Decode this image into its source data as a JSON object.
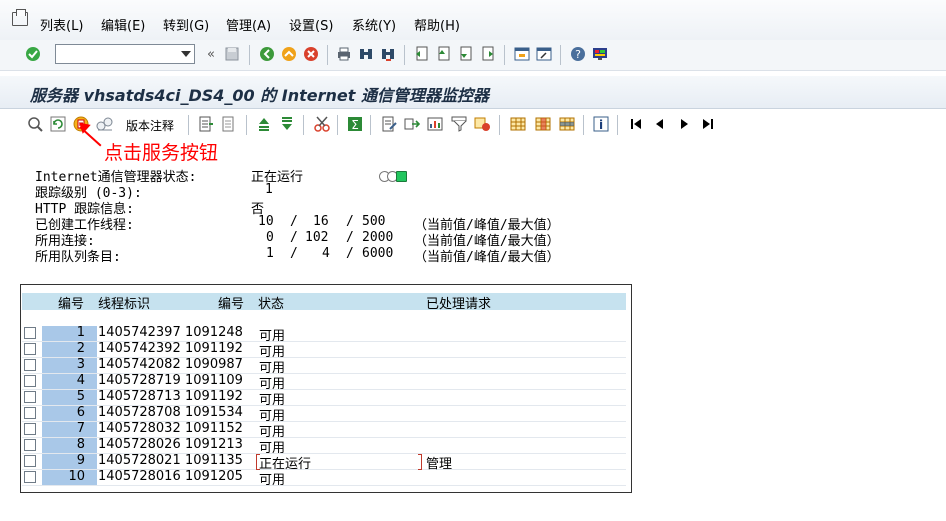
{
  "menu": {
    "items": [
      "列表(L)",
      "编辑(E)",
      "转到(G)",
      "管理(A)",
      "设置(S)",
      "系统(Y)",
      "帮助(H)"
    ]
  },
  "toolbar": {
    "command_value": "",
    "icons": [
      "check-icon",
      "nav-back-icon",
      "save-icon",
      "back-icon",
      "exit-icon",
      "cancel-icon",
      "print-icon",
      "find-icon",
      "find-next-icon",
      "first-page-icon",
      "prev-page-icon",
      "next-page-icon",
      "last-page-icon",
      "new-session-icon",
      "shortcut-icon",
      "help-icon",
      "layout-icon"
    ]
  },
  "title": "服务器 vhsatds4ci_DS4_00 的 Internet 通信管理器监控器",
  "app_toolbar": {
    "notes_label": "版本注释"
  },
  "annotation": "点击服务按钮",
  "status": {
    "rows": [
      {
        "label": "Internet通信管理器状态:",
        "value": "正在运行"
      },
      {
        "label": "跟踪级别 (0-3):",
        "value": "1"
      },
      {
        "label": "HTTP 跟踪信息:",
        "value": "否"
      },
      {
        "label": "已创建工作线程:",
        "current": "10",
        "peak": "16",
        "max": "500",
        "note": "（当前值/峰值/最大值）"
      },
      {
        "label": "所用连接:",
        "current": "0",
        "peak": "102",
        "max": "2000",
        "note": "（当前值/峰值/最大值）"
      },
      {
        "label": "所用队列条目:",
        "current": "1",
        "peak": "4",
        "max": "6000",
        "note": "（当前值/峰值/最大值）"
      }
    ],
    "lamp_colors": [
      "#ffffff",
      "#ffffff",
      "#22c55e"
    ]
  },
  "table": {
    "headers": [
      "编号",
      "线程标识",
      "编号",
      "状态",
      "已处理请求"
    ],
    "rows": [
      {
        "no": "1",
        "thread": "1405742397",
        "pid": "1091248",
        "status": "可用",
        "request": ""
      },
      {
        "no": "2",
        "thread": "1405742392",
        "pid": "1091192",
        "status": "可用",
        "request": ""
      },
      {
        "no": "3",
        "thread": "1405742082",
        "pid": "1090987",
        "status": "可用",
        "request": ""
      },
      {
        "no": "4",
        "thread": "1405728719",
        "pid": "1091109",
        "status": "可用",
        "request": ""
      },
      {
        "no": "5",
        "thread": "1405728713",
        "pid": "1091192",
        "status": "可用",
        "request": ""
      },
      {
        "no": "6",
        "thread": "1405728708",
        "pid": "1091534",
        "status": "可用",
        "request": ""
      },
      {
        "no": "7",
        "thread": "1405728032",
        "pid": "1091152",
        "status": "可用",
        "request": ""
      },
      {
        "no": "8",
        "thread": "1405728026",
        "pid": "1091213",
        "status": "可用",
        "request": ""
      },
      {
        "no": "9",
        "thread": "1405728021",
        "pid": "1091135",
        "status": "正在运行",
        "request": "管理"
      },
      {
        "no": "10",
        "thread": "1405728016",
        "pid": "1091205",
        "status": "可用",
        "request": ""
      }
    ]
  }
}
